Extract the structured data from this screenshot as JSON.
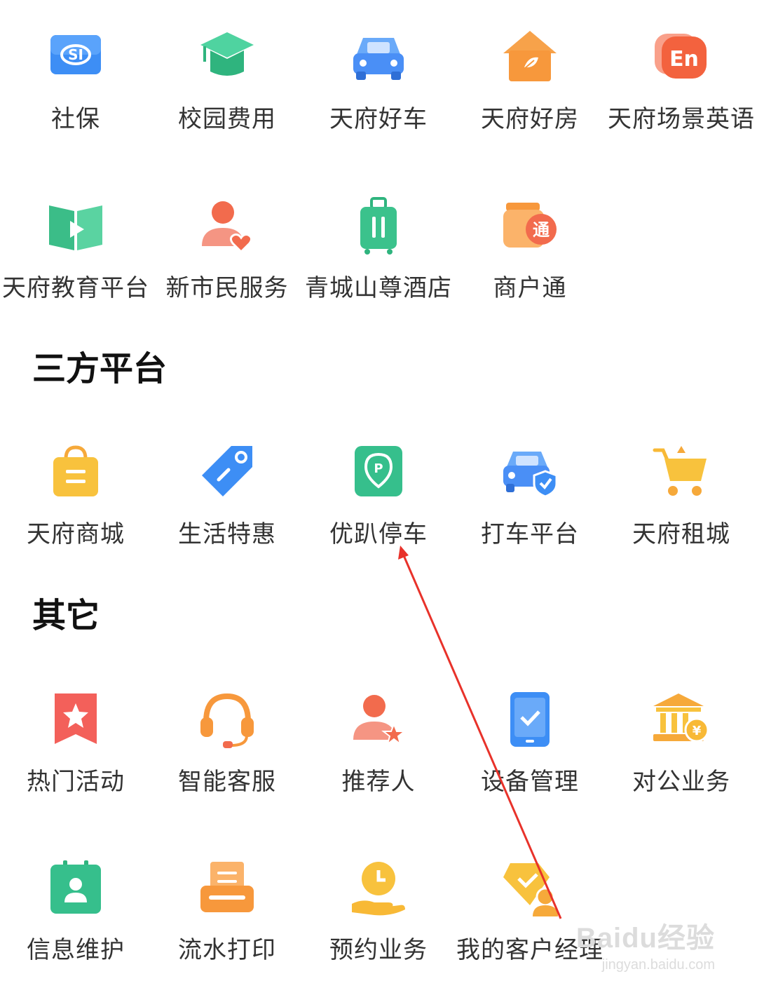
{
  "groups": {
    "top_row1": [
      {
        "label": "社保",
        "icon": "social-security-icon",
        "color": "#3d8ef5"
      },
      {
        "label": "校园费用",
        "icon": "graduation-cap-icon",
        "color": "#37c08c"
      },
      {
        "label": "天府好车",
        "icon": "car-icon",
        "color": "#4a8ff6"
      },
      {
        "label": "天府好房",
        "icon": "house-icon",
        "color": "#f7973a"
      },
      {
        "label": "天府场景英语",
        "icon": "english-chat-icon",
        "color": "#f3623e"
      }
    ],
    "top_row2": [
      {
        "label": "天府教育平台",
        "icon": "book-play-icon",
        "color": "#3bbd88"
      },
      {
        "label": "新市民服务",
        "icon": "person-heart-icon",
        "color": "#f26b4d"
      },
      {
        "label": "青城山尊酒店",
        "icon": "luggage-icon",
        "color": "#3bc28c"
      },
      {
        "label": "商户通",
        "icon": "merchant-jar-icon",
        "color": "#f7983c"
      }
    ]
  },
  "third_party": {
    "title": "三方平台",
    "items": [
      {
        "label": "天府商城",
        "icon": "shopping-bag-icon",
        "color": "#f8c23d"
      },
      {
        "label": "生活特惠",
        "icon": "discount-tag-icon",
        "color": "#3d8ef5"
      },
      {
        "label": "优趴停车",
        "icon": "parking-pin-icon",
        "color": "#36bf8c"
      },
      {
        "label": "打车平台",
        "icon": "car-shield-icon",
        "color": "#4a8ff6"
      },
      {
        "label": "天府租城",
        "icon": "shopping-cart-icon",
        "color": "#f8c23d"
      }
    ]
  },
  "other": {
    "title": "其它",
    "row1": [
      {
        "label": "热门活动",
        "icon": "star-bookmark-icon",
        "color": "#f3605a"
      },
      {
        "label": "智能客服",
        "icon": "headset-icon",
        "color": "#f7983c"
      },
      {
        "label": "推荐人",
        "icon": "person-star-icon",
        "color": "#f26b4d"
      },
      {
        "label": "设备管理",
        "icon": "phone-check-icon",
        "color": "#3d8ef5"
      },
      {
        "label": "对公业务",
        "icon": "bank-yuan-icon",
        "color": "#f8b936"
      }
    ],
    "row2": [
      {
        "label": "信息维护",
        "icon": "contact-card-icon",
        "color": "#36bf8c"
      },
      {
        "label": "流水打印",
        "icon": "printer-icon",
        "color": "#f7983c"
      },
      {
        "label": "预约业务",
        "icon": "clock-hand-icon",
        "color": "#f8c23d"
      },
      {
        "label": "我的客户经理",
        "icon": "manager-badge-icon",
        "color": "#f8c23d"
      }
    ]
  },
  "watermark": {
    "main": "Baidu经验",
    "sub": "jingyan.baidu.com"
  },
  "annotation": {
    "type": "red-arrow",
    "target": "优趴停车",
    "color": "#e8322a"
  }
}
